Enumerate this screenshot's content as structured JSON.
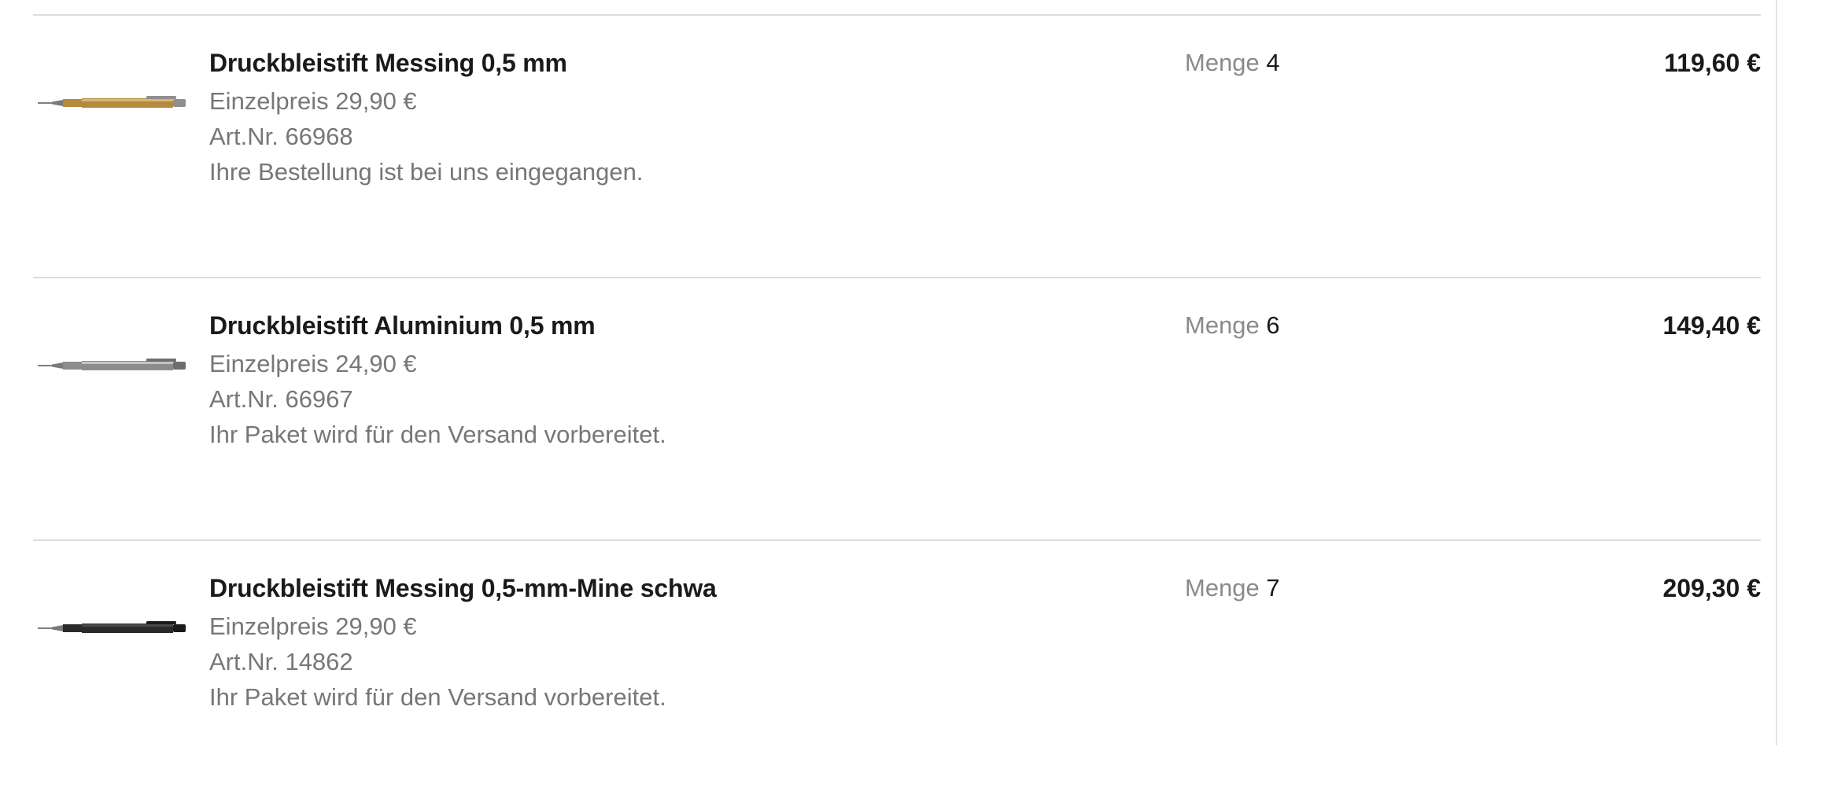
{
  "order": {
    "quantity_label": "Menge",
    "items": [
      {
        "name": "Druckbleistift Messing 0,5 mm",
        "unit_price": "Einzelpreis 29,90 €",
        "article_no": "Art.Nr. 66968",
        "status": "Ihre Bestellung ist bei uns eingegangen.",
        "quantity": "4",
        "total": "119,60 €",
        "image": "pencil-brass-icon",
        "body_color": "#b58a3c",
        "body_highlight": "#d9b770",
        "clip_color": "#8f8f8f"
      },
      {
        "name": "Druckbleistift Aluminium 0,5 mm",
        "unit_price": "Einzelpreis 24,90 €",
        "article_no": "Art.Nr. 66967",
        "status": "Ihr Paket wird für den Versand vorbereitet.",
        "quantity": "6",
        "total": "149,40 €",
        "image": "pencil-aluminium-icon",
        "body_color": "#8c8c8c",
        "body_highlight": "#c4c4c4",
        "clip_color": "#6e6e6e"
      },
      {
        "name": "Druckbleistift Messing 0,5-mm-Mine schwa",
        "unit_price": "Einzelpreis 29,90 €",
        "article_no": "Art.Nr. 14862",
        "status": "Ihr Paket wird für den Versand vorbereitet.",
        "quantity": "7",
        "total": "209,30 €",
        "image": "pencil-black-icon",
        "body_color": "#2a2a2a",
        "body_highlight": "#4a4a4a",
        "clip_color": "#1a1a1a"
      }
    ]
  }
}
